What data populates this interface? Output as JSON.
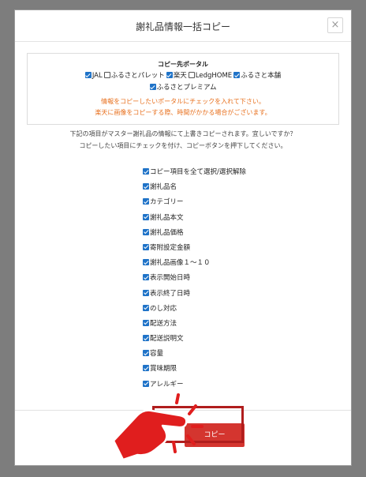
{
  "dialog": {
    "title": "謝礼品情報一括コピー",
    "close_label": "×"
  },
  "portal": {
    "heading": "コピー先ポータル",
    "row1": [
      {
        "label": "JAL",
        "checked": true
      },
      {
        "label": "ふるさとパレット",
        "checked": false
      },
      {
        "label": "楽天",
        "checked": true
      },
      {
        "label": "LedgHOME",
        "checked": false
      },
      {
        "label": "ふるさと本舗",
        "checked": true
      }
    ],
    "row2": [
      {
        "label": "ふるさとプレミアム",
        "checked": true
      }
    ],
    "note1": "情報をコピーしたいポータルにチェックを入れて下さい。",
    "note2": "楽天に画像をコピーする際、時間がかかる場合がございます。",
    "note_color": "#e8711f"
  },
  "description": {
    "line1": "下記の項目がマスター謝礼品の情報にて上書きコピーされます。宜しいですか？",
    "line2": "コピーしたい項目にチェックを付け、コピーボタンを押下してください。"
  },
  "items": [
    {
      "label": "コピー項目を全て選択/選択解除",
      "checked": true
    },
    {
      "label": "謝礼品名",
      "checked": true
    },
    {
      "label": "カテゴリー",
      "checked": true
    },
    {
      "label": "謝礼品本文",
      "checked": true
    },
    {
      "label": "謝礼品価格",
      "checked": true
    },
    {
      "label": "寄附設定金額",
      "checked": true
    },
    {
      "label": "謝礼品画像１～１０",
      "checked": true
    },
    {
      "label": "表示開始日時",
      "checked": true
    },
    {
      "label": "表示終了日時",
      "checked": true
    },
    {
      "label": "のし対応",
      "checked": true
    },
    {
      "label": "配送方法",
      "checked": true
    },
    {
      "label": "配送説明文",
      "checked": true
    },
    {
      "label": "容量",
      "checked": true
    },
    {
      "label": "賞味期限",
      "checked": true
    },
    {
      "label": "アレルギー",
      "checked": true
    }
  ],
  "footer": {
    "copy_button": "コピー",
    "button_color": "#d4352f"
  },
  "colors": {
    "checkbox": "#1f73c8",
    "highlight": "#b01d1d",
    "hand": "#e01e1e"
  }
}
